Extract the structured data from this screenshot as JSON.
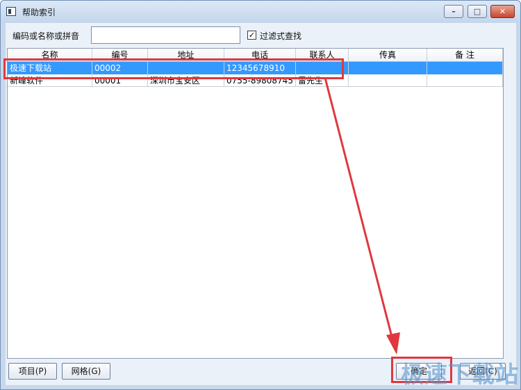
{
  "window": {
    "title": "帮助索引",
    "controls": {
      "minimize": "–",
      "maximize": "□",
      "close": "✕"
    }
  },
  "search": {
    "label": "编码或名称或拼音",
    "value": "",
    "filter_checked": true,
    "filter_mark": "✓",
    "filter_label": "过滤式查找"
  },
  "grid": {
    "columns": [
      "名称",
      "编号",
      "地址",
      "电话",
      "联系人",
      "传真",
      "备 注"
    ],
    "rows": [
      [
        "极速下载站",
        "00002",
        "",
        "12345678910",
        "",
        "",
        ""
      ],
      [
        "新峰软件",
        "00001",
        "深圳市宝安区",
        "0755-89808745",
        "雷先生",
        "",
        ""
      ]
    ],
    "selected_row": 0
  },
  "buttons": {
    "items": "项目(P)",
    "grid": "网格(G)",
    "ok": "确定",
    "cancel": "返回(C)"
  },
  "annotations": {
    "color": "#e0383e"
  },
  "watermark": "极速下载站"
}
